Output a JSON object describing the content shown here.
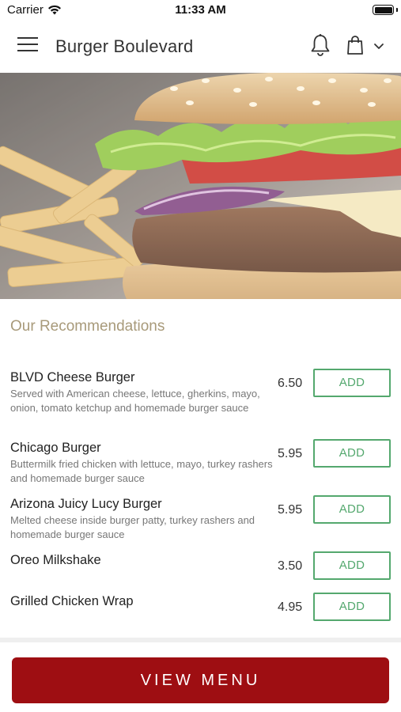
{
  "status_bar": {
    "carrier": "Carrier",
    "time": "11:33 AM"
  },
  "header": {
    "title": "Burger Boulevard",
    "icons": [
      "menu-icon",
      "bell-icon",
      "shopping-bag-icon",
      "chevron-down-icon"
    ]
  },
  "hero": {
    "image": "burger-with-fries-photo"
  },
  "recommendations": {
    "title": "Our Recommendations",
    "add_label": "ADD",
    "items": [
      {
        "name": "BLVD Cheese Burger",
        "description": "Served with American cheese, lettuce, gherkins, mayo, onion, tomato ketchup and homemade burger sauce",
        "price": "6.50"
      },
      {
        "name": "Chicago Burger",
        "description": "Buttermilk fried chicken with lettuce, mayo, turkey rashers and homemade burger sauce",
        "price": "5.95"
      },
      {
        "name": "Arizona Juicy Lucy Burger",
        "description": "Melted cheese inside burger patty, turkey rashers and homemade burger sauce",
        "price": "5.95"
      },
      {
        "name": "Oreo Milkshake",
        "description": "",
        "price": "3.50"
      },
      {
        "name": "Grilled Chicken Wrap",
        "description": "",
        "price": "4.95"
      }
    ]
  },
  "footer": {
    "view_menu_label": "VIEW MENU"
  },
  "colors": {
    "accent_red": "#9e0e12",
    "add_green": "#54a86e",
    "section_title": "#a89a7a"
  }
}
